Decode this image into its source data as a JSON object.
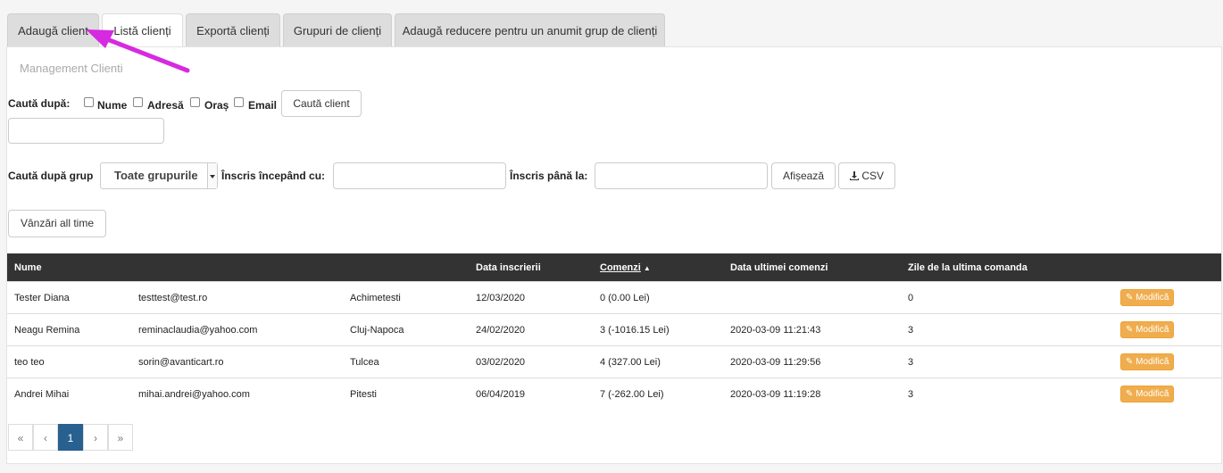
{
  "tabs": [
    {
      "label": "Adaugă client"
    },
    {
      "label": "Listă clienți"
    },
    {
      "label": "Exportă clienți"
    },
    {
      "label": "Grupuri de clienți"
    },
    {
      "label": "Adaugă reducere pentru un anumit grup de clienți"
    }
  ],
  "subtitle": "Management Clienti",
  "search": {
    "label": "Caută după:",
    "options": [
      "Nume",
      "Adresă",
      "Oraș",
      "Email"
    ],
    "button": "Caută client",
    "value": ""
  },
  "group_filter": {
    "label": "Caută după grup",
    "selected": "Toate grupurile",
    "from_label": "Înscris începând cu:",
    "to_label": "Înscris până la:",
    "show_button": "Afișează",
    "csv_button": "CSV"
  },
  "sales_button": "Vânzări all time",
  "table": {
    "headers": {
      "name": "Nume",
      "signup_date": "Data inscrierii",
      "orders": "Comenzi",
      "last_order": "Data ultimei comenzi",
      "days_since": "Zile de la ultima comanda"
    },
    "rows": [
      {
        "name": "Tester Diana",
        "email": "testtest@test.ro",
        "city": "Achimetesti",
        "date": "12/03/2020",
        "orders": "0 (0.00 Lei)",
        "last": "",
        "days": "0",
        "action": "Modifică"
      },
      {
        "name": "Neagu Remina",
        "email": "reminaclaudia@yahoo.com",
        "city": "Cluj-Napoca",
        "date": "24/02/2020",
        "orders": "3 (-1016.15 Lei)",
        "last": "2020-03-09 11:21:43",
        "days": "3",
        "action": "Modifică"
      },
      {
        "name": "teo teo",
        "email": "sorin@avanticart.ro",
        "city": "Tulcea",
        "date": "03/02/2020",
        "orders": "4 (327.00 Lei)",
        "last": "2020-03-09 11:29:56",
        "days": "3",
        "action": "Modifică"
      },
      {
        "name": "Andrei Mihai",
        "email": "mihai.andrei@yahoo.com",
        "city": "Pitesti",
        "date": "06/04/2019",
        "orders": "7 (-262.00 Lei)",
        "last": "2020-03-09 11:19:28",
        "days": "3",
        "action": "Modifică"
      }
    ]
  },
  "pagination": {
    "first": "«",
    "prev": "‹",
    "current": "1",
    "next": "›",
    "last": "»"
  },
  "colors": {
    "accent_arrow": "#d62ae0",
    "edit_button": "#f0ad4e",
    "page_active": "#286090"
  }
}
